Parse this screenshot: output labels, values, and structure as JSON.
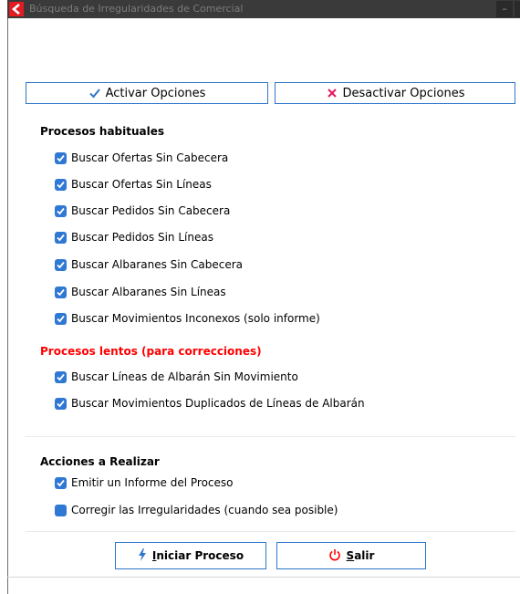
{
  "window": {
    "title": "Búsqueda de Irregularidades de Comercial",
    "minimize_label": "–",
    "close_label": "×"
  },
  "toolbar": {
    "activate_label": "Activar Opciones",
    "deactivate_label": "Desactivar Opciones"
  },
  "sections": {
    "habituales": {
      "title": "Procesos habituales",
      "items": [
        {
          "label": "Buscar Ofertas Sin Cabecera",
          "checked": true
        },
        {
          "label": "Buscar Ofertas Sin Líneas",
          "checked": true
        },
        {
          "label": "Buscar Pedidos Sin Cabecera",
          "checked": true
        },
        {
          "label": "Buscar Pedidos Sin Líneas",
          "checked": true
        },
        {
          "label": "Buscar Albaranes Sin Cabecera",
          "checked": true
        },
        {
          "label": "Buscar Albaranes Sin Líneas",
          "checked": true
        },
        {
          "label": "Buscar Movimientos Inconexos (solo informe)",
          "checked": true
        }
      ]
    },
    "lentos": {
      "title": "Procesos lentos (para correcciones)",
      "title_color": "#ff0000",
      "items": [
        {
          "label": "Buscar Líneas de Albarán Sin Movimiento",
          "checked": true
        },
        {
          "label": "Buscar Movimientos Duplicados de Líneas de Albarán",
          "checked": true
        }
      ]
    },
    "acciones": {
      "title": "Acciones a Realizar",
      "items": [
        {
          "label": "Emitir un Informe del Proceso",
          "checked": true
        },
        {
          "label": "Corregir las Irregularidades (cuando sea posible)",
          "checked": false
        }
      ]
    }
  },
  "footer": {
    "start_label": "Iniciar Proceso",
    "exit_label": "Salir"
  },
  "colors": {
    "accent": "#2f78d4",
    "titlebar": "#3a3a3a",
    "brand_red": "#e31b23"
  },
  "icons": {
    "activate": "check-icon",
    "deactivate": "x-icon",
    "start": "lightning-icon",
    "exit": "power-icon"
  }
}
